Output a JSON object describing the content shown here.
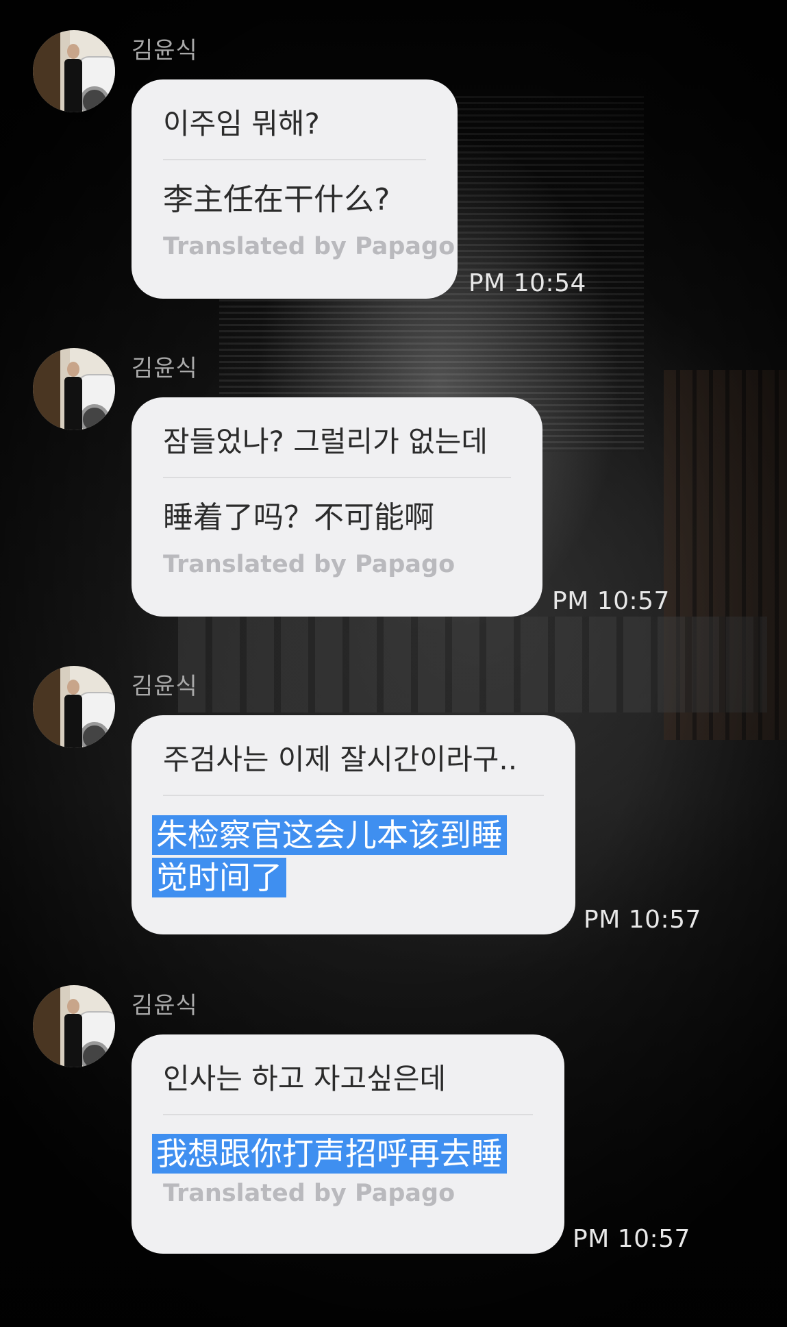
{
  "messages": [
    {
      "sender": "김윤식",
      "original": "이주임 뭐해?",
      "translation": "李主任在干什么?",
      "credit": "Translated by Papago",
      "time": "PM 10:54"
    },
    {
      "sender": "김윤식",
      "original": "잠들었나? 그럴리가 없는데",
      "translation": "睡着了吗？不可能啊",
      "credit": "Translated by Papago",
      "time": "PM 10:57"
    },
    {
      "sender": "김윤식",
      "original": "주검사는 이제 잘시간이라구..",
      "translation_line1": "朱检察官这会儿本该到睡",
      "translation_line2": "觉时间了",
      "time": "PM 10:57"
    },
    {
      "sender": "김윤식",
      "original": "인사는 하고 자고싶은데",
      "translation": "我想跟你打声招呼再去睡",
      "credit": "Translated by Papago",
      "time": "PM 10:57"
    }
  ],
  "colors": {
    "bubble": "#f0f0f2",
    "highlight": "#3f8ff0",
    "name": "#a9a9a9",
    "time": "#e8e8e8"
  }
}
